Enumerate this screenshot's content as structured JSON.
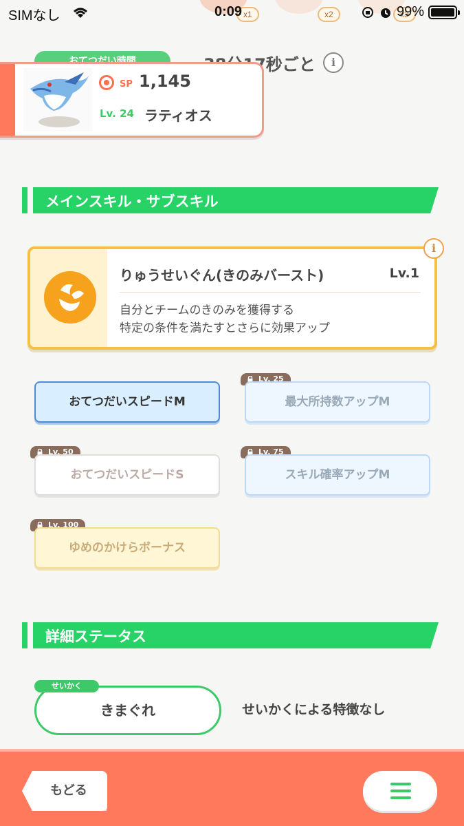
{
  "status_bar": {
    "carrier": "SIMなし",
    "time": "0:09",
    "battery": "99%",
    "battery_level": 0.99
  },
  "top_peek": {
    "badges": [
      "x1",
      "x2",
      "x3"
    ]
  },
  "helper": {
    "label": "おてつだい時間",
    "interval": "38分17秒ごと"
  },
  "pokemon": {
    "sp_label": "SP",
    "sp_value": "1,145",
    "level": "Lv. 24",
    "name": "ラティオス"
  },
  "skills_section": {
    "title": "メインスキル・サブスキル"
  },
  "main_skill": {
    "name": "りゅうせいぐん(きのみバースト)",
    "level": "Lv.1",
    "desc_line1": "自分とチームのきのみを獲得する",
    "desc_line2": "特定の条件を満たすとさらに効果アップ"
  },
  "sub_skills": [
    {
      "label": "おてつだいスピードM",
      "lock": ""
    },
    {
      "label": "最大所持数アップM",
      "lock": "Lv. 25"
    },
    {
      "label": "おてつだいスピードS",
      "lock": "Lv. 50"
    },
    {
      "label": "スキル確率アップM",
      "lock": "Lv. 75"
    },
    {
      "label": "ゆめのかけらボーナス",
      "lock": "Lv. 100"
    }
  ],
  "details_section": {
    "title": "詳細ステータス"
  },
  "nature": {
    "tag": "せいかく",
    "value": "きまぐれ",
    "description": "せいかくによる特徴なし"
  },
  "footer": {
    "back_label": "もどる"
  },
  "colors": {
    "accent_green": "#27d366",
    "footer_orange": "#ff7a5c",
    "skill_gold": "#f5bf44"
  }
}
